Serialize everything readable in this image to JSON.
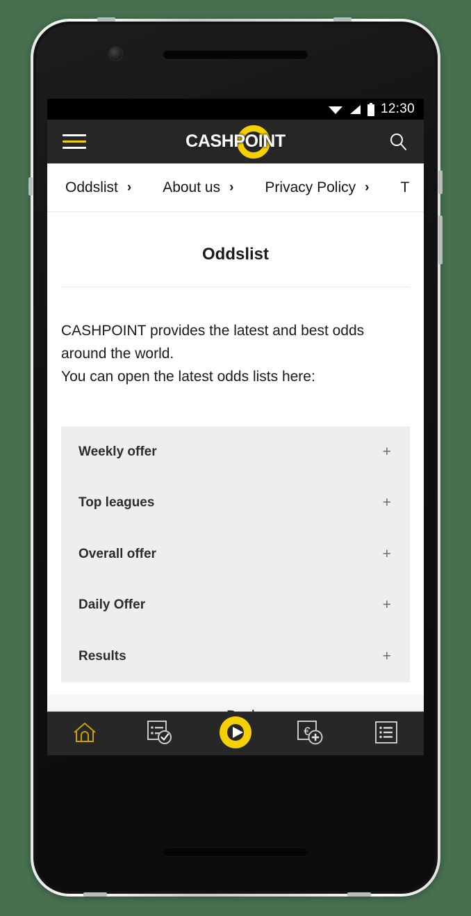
{
  "status_bar": {
    "time": "12:30",
    "icons": [
      "wifi-icon",
      "cellular-signal-icon",
      "battery-icon"
    ]
  },
  "header": {
    "menu_icon": "hamburger-menu-icon",
    "brand": "CASHPOINT",
    "search_icon": "search-icon",
    "background_color": "#272727",
    "accent_color": "#f5d000"
  },
  "nav": {
    "items": [
      {
        "label": "Oddslist",
        "chevron": "›"
      },
      {
        "label": "About us",
        "chevron": "›"
      },
      {
        "label": "Privacy Policy",
        "chevron": "›"
      },
      {
        "label": "T",
        "chevron": ""
      }
    ]
  },
  "content": {
    "title": "Oddslist",
    "paragraph_line_1": "CASHPOINT provides the latest and best odds",
    "paragraph_line_2": "around the world.",
    "paragraph_line_3": "You can open the latest odds lists here:"
  },
  "accordion": {
    "expand_symbol": "+",
    "items": [
      {
        "label": "Weekly offer"
      },
      {
        "label": "Top leagues"
      },
      {
        "label": "Overall offer"
      },
      {
        "label": "Daily Offer"
      },
      {
        "label": "Results"
      }
    ]
  },
  "back_bar": {
    "chevron": "‹",
    "label": "Back"
  },
  "bottom_nav": {
    "items": [
      {
        "name": "home-icon",
        "active": true
      },
      {
        "name": "betslip-check-icon",
        "active": false
      },
      {
        "name": "live-play-icon",
        "active": false
      },
      {
        "name": "deposit-euro-icon",
        "active": false
      },
      {
        "name": "list-menu-icon",
        "active": false
      }
    ],
    "background_color": "#272727",
    "active_color": "#c9a200"
  },
  "page_background_color": "#487050"
}
